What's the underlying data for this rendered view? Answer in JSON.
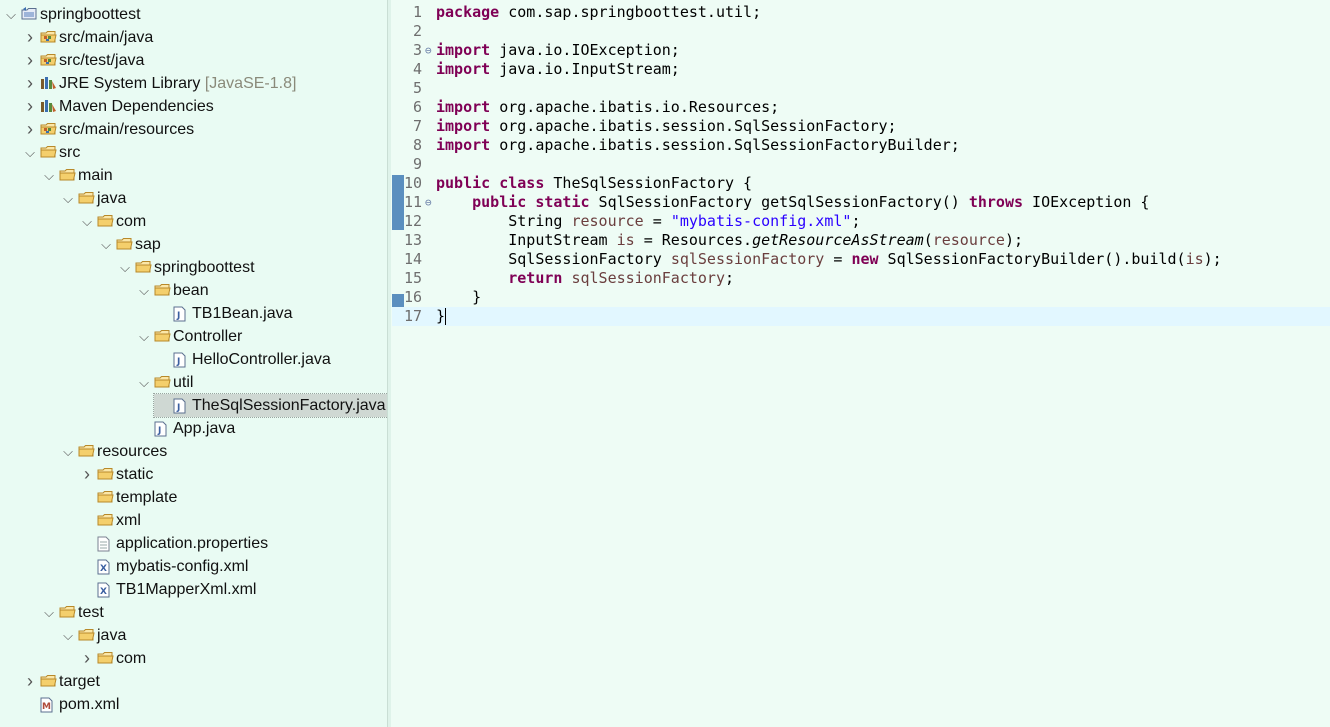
{
  "explorer": {
    "items": [
      {
        "label": "springboottest",
        "depth": 0,
        "chevron": "down",
        "icon": "project-icon"
      },
      {
        "label": "src/main/java",
        "depth": 1,
        "chevron": "right",
        "icon": "source-folder-icon"
      },
      {
        "label": "src/test/java",
        "depth": 1,
        "chevron": "right",
        "icon": "source-folder-icon"
      },
      {
        "label": "JRE System Library",
        "decoration": "[JavaSE-1.8]",
        "depth": 1,
        "chevron": "right",
        "icon": "library-icon"
      },
      {
        "label": "Maven Dependencies",
        "depth": 1,
        "chevron": "right",
        "icon": "library-icon"
      },
      {
        "label": "src/main/resources",
        "depth": 1,
        "chevron": "right",
        "icon": "source-folder-icon"
      },
      {
        "label": "src",
        "depth": 1,
        "chevron": "down",
        "icon": "folder-icon"
      },
      {
        "label": "main",
        "depth": 2,
        "chevron": "down",
        "icon": "folder-icon"
      },
      {
        "label": "java",
        "depth": 3,
        "chevron": "down",
        "icon": "folder-icon"
      },
      {
        "label": "com",
        "depth": 4,
        "chevron": "down",
        "icon": "folder-icon"
      },
      {
        "label": "sap",
        "depth": 5,
        "chevron": "down",
        "icon": "folder-icon"
      },
      {
        "label": "springboottest",
        "depth": 6,
        "chevron": "down",
        "icon": "folder-icon"
      },
      {
        "label": "bean",
        "depth": 7,
        "chevron": "down",
        "icon": "folder-icon"
      },
      {
        "label": "TB1Bean.java",
        "depth": 8,
        "chevron": "none",
        "icon": "java-file-icon"
      },
      {
        "label": "Controller",
        "depth": 7,
        "chevron": "down",
        "icon": "folder-icon"
      },
      {
        "label": "HelloController.java",
        "depth": 8,
        "chevron": "none",
        "icon": "java-file-icon"
      },
      {
        "label": "util",
        "depth": 7,
        "chevron": "down",
        "icon": "folder-icon"
      },
      {
        "label": "TheSqlSessionFactory.java",
        "depth": 8,
        "chevron": "none",
        "icon": "java-file-icon",
        "selected": true
      },
      {
        "label": "App.java",
        "depth": 7,
        "chevron": "none",
        "icon": "java-file-icon"
      },
      {
        "label": "resources",
        "depth": 3,
        "chevron": "down",
        "icon": "folder-icon"
      },
      {
        "label": "static",
        "depth": 4,
        "chevron": "right",
        "icon": "folder-icon"
      },
      {
        "label": "template",
        "depth": 4,
        "chevron": "none",
        "icon": "folder-icon"
      },
      {
        "label": "xml",
        "depth": 4,
        "chevron": "none",
        "icon": "folder-icon"
      },
      {
        "label": "application.properties",
        "depth": 4,
        "chevron": "none",
        "icon": "text-file-icon"
      },
      {
        "label": "mybatis-config.xml",
        "depth": 4,
        "chevron": "none",
        "icon": "xml-file-icon"
      },
      {
        "label": "TB1MapperXml.xml",
        "depth": 4,
        "chevron": "none",
        "icon": "xml-file-icon"
      },
      {
        "label": "test",
        "depth": 2,
        "chevron": "down",
        "icon": "folder-icon"
      },
      {
        "label": "java",
        "depth": 3,
        "chevron": "down",
        "icon": "folder-icon"
      },
      {
        "label": "com",
        "depth": 4,
        "chevron": "right",
        "icon": "folder-icon"
      },
      {
        "label": "target",
        "depth": 1,
        "chevron": "right",
        "icon": "folder-icon"
      },
      {
        "label": "pom.xml",
        "depth": 1,
        "chevron": "none",
        "icon": "maven-file-icon"
      }
    ]
  },
  "editor": {
    "current_line": 17,
    "lines": [
      {
        "n": "1",
        "fold": "",
        "tokens": [
          [
            "kw",
            "package"
          ],
          [
            "p",
            " com.sap.springboottest.util;"
          ]
        ]
      },
      {
        "n": "2",
        "fold": "",
        "tokens": []
      },
      {
        "n": "3",
        "fold": "⊖",
        "tokens": [
          [
            "kw",
            "import"
          ],
          [
            "p",
            " java.io.IOException;"
          ]
        ]
      },
      {
        "n": "4",
        "fold": "",
        "tokens": [
          [
            "kw",
            "import"
          ],
          [
            "p",
            " java.io.InputStream;"
          ]
        ]
      },
      {
        "n": "5",
        "fold": "",
        "tokens": []
      },
      {
        "n": "6",
        "fold": "",
        "tokens": [
          [
            "kw",
            "import"
          ],
          [
            "p",
            " org.apache.ibatis.io.Resources;"
          ]
        ]
      },
      {
        "n": "7",
        "fold": "",
        "tokens": [
          [
            "kw",
            "import"
          ],
          [
            "p",
            " org.apache.ibatis.session.SqlSessionFactory;"
          ]
        ]
      },
      {
        "n": "8",
        "fold": "",
        "tokens": [
          [
            "kw",
            "import"
          ],
          [
            "p",
            " org.apache.ibatis.session.SqlSessionFactoryBuilder;"
          ]
        ]
      },
      {
        "n": "9",
        "fold": "",
        "tokens": []
      },
      {
        "n": "10",
        "fold": "",
        "tokens": [
          [
            "kw",
            "public"
          ],
          [
            "p",
            " "
          ],
          [
            "kw",
            "class"
          ],
          [
            "p",
            " TheSqlSessionFactory {"
          ]
        ]
      },
      {
        "n": "11",
        "fold": "⊖",
        "tokens": [
          [
            "p",
            "    "
          ],
          [
            "kw",
            "public"
          ],
          [
            "p",
            " "
          ],
          [
            "kw",
            "static"
          ],
          [
            "p",
            " SqlSessionFactory getSqlSessionFactory() "
          ],
          [
            "kw",
            "throws"
          ],
          [
            "p",
            " IOException {"
          ]
        ]
      },
      {
        "n": "12",
        "fold": "",
        "tokens": [
          [
            "p",
            "        String "
          ],
          [
            "var",
            "resource"
          ],
          [
            "p",
            " = "
          ],
          [
            "str",
            "\"mybatis-config.xml\""
          ],
          [
            "p",
            ";"
          ]
        ]
      },
      {
        "n": "13",
        "fold": "",
        "tokens": [
          [
            "p",
            "        InputStream "
          ],
          [
            "var",
            "is"
          ],
          [
            "p",
            " = Resources."
          ],
          [
            "it",
            "getResourceAsStream"
          ],
          [
            "p",
            "("
          ],
          [
            "var",
            "resource"
          ],
          [
            "p",
            ");"
          ]
        ]
      },
      {
        "n": "14",
        "fold": "",
        "tokens": [
          [
            "p",
            "        SqlSessionFactory "
          ],
          [
            "var",
            "sqlSessionFactory"
          ],
          [
            "p",
            " = "
          ],
          [
            "kw",
            "new"
          ],
          [
            "p",
            " SqlSessionFactoryBuilder().build("
          ],
          [
            "var",
            "is"
          ],
          [
            "p",
            ");"
          ]
        ]
      },
      {
        "n": "15",
        "fold": "",
        "tokens": [
          [
            "p",
            "        "
          ],
          [
            "kw",
            "return"
          ],
          [
            "p",
            " "
          ],
          [
            "var",
            "sqlSessionFactory"
          ],
          [
            "p",
            ";"
          ]
        ]
      },
      {
        "n": "16",
        "fold": "",
        "tokens": [
          [
            "p",
            "    }"
          ]
        ]
      },
      {
        "n": "17",
        "fold": "",
        "tokens": [
          [
            "p",
            "}"
          ]
        ]
      }
    ]
  },
  "colors": {
    "explorer_bg": "#e9fbf3",
    "editor_bg": "#eefcf5",
    "keyword": "#7f0055",
    "string": "#2a00ff",
    "variable": "#6a3e3e",
    "selection": "#cfd8d3",
    "current_line": "#e2f7ff"
  }
}
